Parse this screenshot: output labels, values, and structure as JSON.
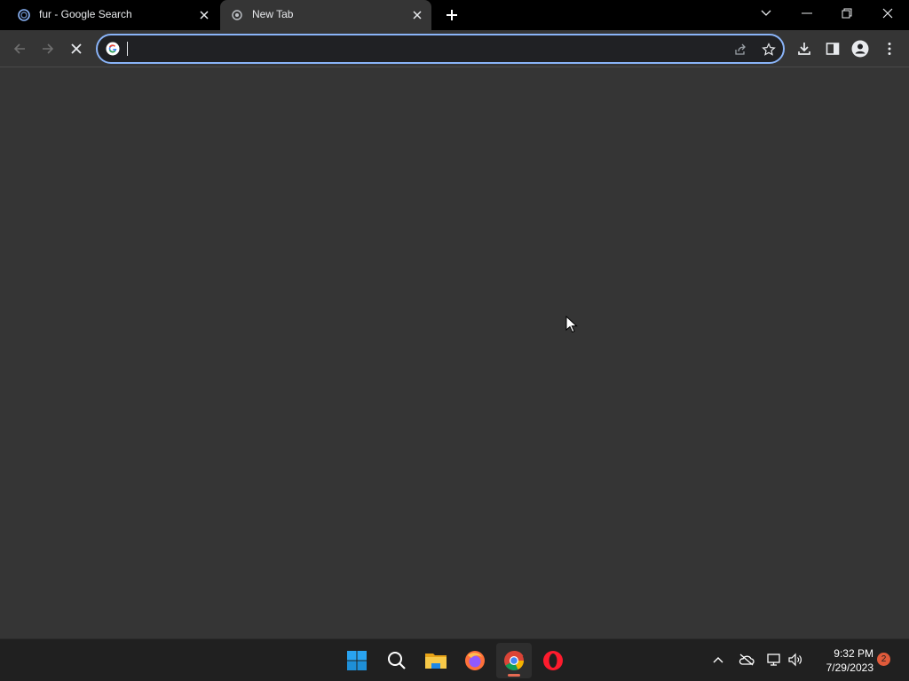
{
  "tabs": [
    {
      "title": "fur - Google Search",
      "active": false,
      "favicon": "google-search-loading-icon"
    },
    {
      "title": "New Tab",
      "active": true,
      "favicon": "chrome-newtab-icon"
    }
  ],
  "omnibox": {
    "value": "",
    "placeholder": ""
  },
  "taskbar": {
    "apps": [
      "start-button",
      "search-button",
      "file-explorer",
      "firefox",
      "chrome",
      "opera"
    ],
    "active_app": "chrome",
    "time": "9:32 PM",
    "date": "7/29/2023",
    "notification_count": "2"
  },
  "colors": {
    "tabstrip": "#000000",
    "toolbar": "#353535",
    "omnibox_focus": "#8ab4f8",
    "content": "#353535",
    "taskbar": "#202020"
  }
}
